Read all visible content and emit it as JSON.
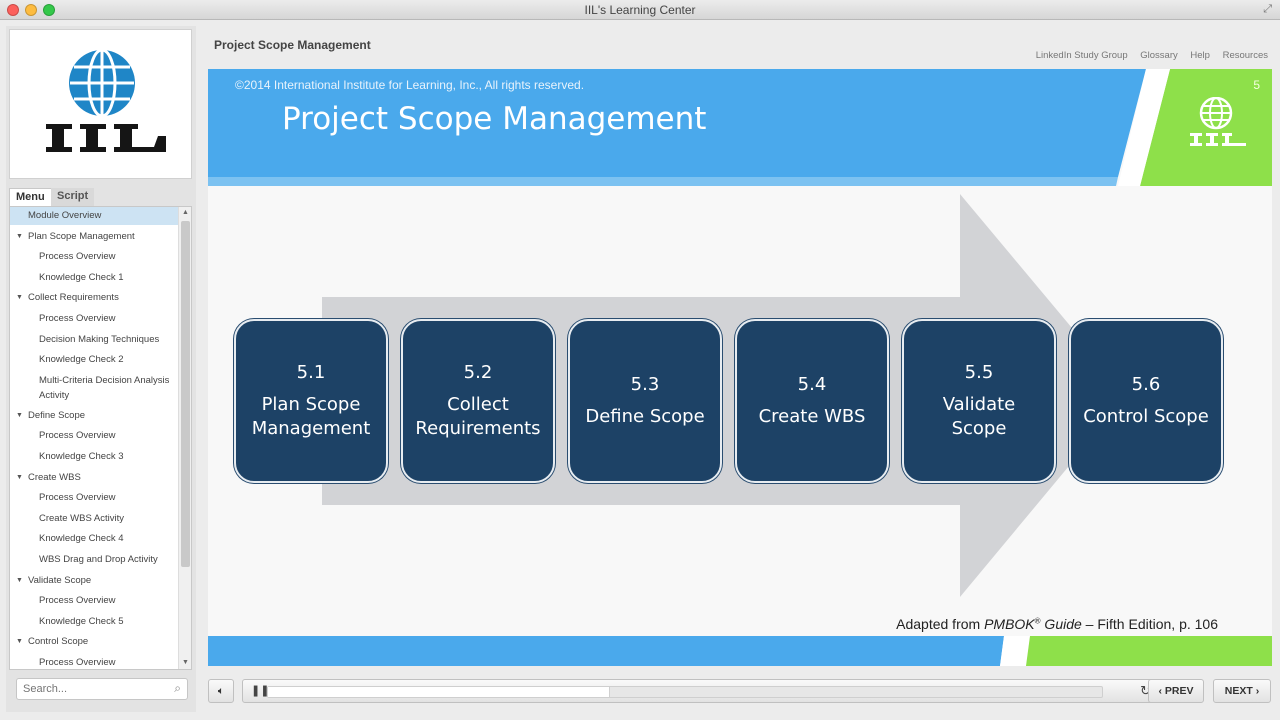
{
  "window": {
    "title": "IIL's Learning Center"
  },
  "sidebar": {
    "tabs": [
      "Menu",
      "Script"
    ],
    "menu": [
      {
        "label": "Module Overview",
        "level": "section",
        "active": true
      },
      {
        "label": "Plan Scope Management",
        "level": "section",
        "expand": true
      },
      {
        "label": "Process Overview",
        "level": "child"
      },
      {
        "label": "Knowledge Check 1",
        "level": "child"
      },
      {
        "label": "Collect Requirements",
        "level": "section",
        "expand": true
      },
      {
        "label": "Process Overview",
        "level": "child"
      },
      {
        "label": "Decision Making Techniques",
        "level": "child"
      },
      {
        "label": "Knowledge Check 2",
        "level": "child"
      },
      {
        "label": "Multi-Criteria Decision Analysis Activity",
        "level": "child",
        "wrap": true
      },
      {
        "label": "Define Scope",
        "level": "section",
        "expand": true
      },
      {
        "label": "Process Overview",
        "level": "child"
      },
      {
        "label": "Knowledge Check 3",
        "level": "child"
      },
      {
        "label": "Create WBS",
        "level": "section",
        "expand": true
      },
      {
        "label": "Process Overview",
        "level": "child"
      },
      {
        "label": "Create WBS Activity",
        "level": "child"
      },
      {
        "label": "Knowledge Check 4",
        "level": "child"
      },
      {
        "label": "WBS Drag and Drop Activity",
        "level": "child"
      },
      {
        "label": "Validate Scope",
        "level": "section",
        "expand": true
      },
      {
        "label": "Process Overview",
        "level": "child"
      },
      {
        "label": "Knowledge Check 5",
        "level": "child"
      },
      {
        "label": "Control Scope",
        "level": "section",
        "expand": true
      },
      {
        "label": "Process Overview",
        "level": "child"
      }
    ],
    "search_placeholder": "Search...",
    "logo_text": "IIL"
  },
  "main": {
    "module_title": "Project Scope Management",
    "links": [
      "LinkedIn Study Group",
      "Glossary",
      "Help",
      "Resources"
    ]
  },
  "slide": {
    "title": "Project Scope Management",
    "steps": [
      {
        "num": "5.1",
        "name": "Plan Scope\nManagement"
      },
      {
        "num": "5.2",
        "name": "Collect\nRequirements"
      },
      {
        "num": "5.3",
        "name": "Define Scope"
      },
      {
        "num": "5.4",
        "name": "Create WBS"
      },
      {
        "num": "5.5",
        "name": "Validate\nScope"
      },
      {
        "num": "5.6",
        "name": "Control Scope"
      }
    ],
    "caption_prefix": "Adapted from ",
    "caption_italic": "PMBOK",
    "caption_reg": "®",
    "caption_italic2": " Guide",
    "caption_suffix": " – Fifth Edition, p. 106",
    "copyright": "©2014 International Institute for Learning, Inc., All rights reserved.",
    "page_number": "5",
    "colors": {
      "header_blue": "#4aa9ec",
      "accent_green": "#8ee04a",
      "box_navy": "#1d4266",
      "arrow_gray": "#d2d3d6"
    }
  },
  "player": {
    "prev_label": "PREV",
    "next_label": "NEXT",
    "progress": 0.41
  }
}
